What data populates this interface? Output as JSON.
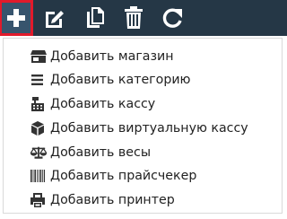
{
  "toolbar": {
    "background": "#253746",
    "active_outline": "#e11a2b",
    "buttons": [
      {
        "name": "add",
        "icon": "plus-icon"
      },
      {
        "name": "edit",
        "icon": "edit-icon"
      },
      {
        "name": "copy",
        "icon": "copy-icon"
      },
      {
        "name": "delete",
        "icon": "trash-icon"
      },
      {
        "name": "refresh",
        "icon": "refresh-icon"
      }
    ]
  },
  "menu": {
    "items": [
      {
        "label": "Добавить магазин",
        "icon": "store-icon"
      },
      {
        "label": "Добавить категорию",
        "icon": "list-icon"
      },
      {
        "label": "Добавить кассу",
        "icon": "cash-register-icon"
      },
      {
        "label": "Добавить виртуальную кассу",
        "icon": "cube-icon"
      },
      {
        "label": "Добавить весы",
        "icon": "scale-icon"
      },
      {
        "label": "Добавить прайсчекер",
        "icon": "barcode-icon"
      },
      {
        "label": "Добавить принтер",
        "icon": "printer-icon"
      }
    ]
  }
}
